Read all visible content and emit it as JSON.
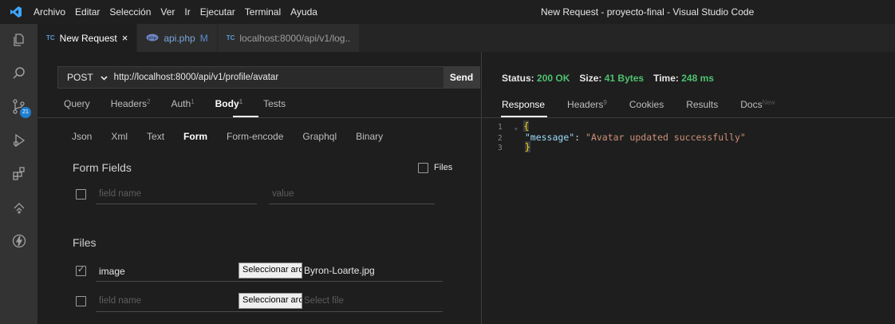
{
  "titlebar": {
    "logo": "⟩⟨",
    "menu": [
      "Archivo",
      "Editar",
      "Selección",
      "Ver",
      "Ir",
      "Ejecutar",
      "Terminal",
      "Ayuda"
    ],
    "window_title": "New Request - proyecto-final - Visual Studio Code"
  },
  "activity": {
    "icons": [
      "files-icon",
      "search-icon",
      "source-control-icon",
      "run-debug-icon",
      "extensions-icon",
      "remote-icon",
      "thunder-client-icon"
    ],
    "source_control_badge": "21"
  },
  "tabs": [
    {
      "label": "New Request",
      "prefix": "TC",
      "close": "×",
      "active": true
    },
    {
      "label": "api.php",
      "prefix": "php-icon",
      "modified": "M"
    },
    {
      "label": "localhost:8000/api/v1/log..",
      "prefix": "TC"
    }
  ],
  "request": {
    "method": "POST",
    "url": "http://localhost:8000/api/v1/profile/avatar",
    "send_label": "Send",
    "tabs": [
      {
        "label": "Query"
      },
      {
        "label": "Headers",
        "count": "2"
      },
      {
        "label": "Auth",
        "count": "1"
      },
      {
        "label": "Body",
        "count": "1",
        "active": true
      },
      {
        "label": "Tests"
      }
    ],
    "body_tabs": [
      "Json",
      "Xml",
      "Text",
      "Form",
      "Form-encode",
      "Graphql",
      "Binary"
    ],
    "body_tab_active": "Form",
    "form_fields_title": "Form Fields",
    "files_toggle_label": "Files",
    "field_name_placeholder": "field name",
    "value_placeholder": "value",
    "files_title": "Files",
    "file_rows": [
      {
        "name": "image",
        "button": "Seleccionar archivo",
        "file": "Byron-Loarte.jpg",
        "checked": true
      },
      {
        "name_placeholder": "field name",
        "button": "Seleccionar archivo",
        "file_placeholder": "Select file",
        "checked": false
      }
    ]
  },
  "response": {
    "status_label": "Status:",
    "status_value": "200 OK",
    "size_label": "Size:",
    "size_value": "41 Bytes",
    "time_label": "Time:",
    "time_value": "248 ms",
    "tabs": [
      {
        "label": "Response",
        "active": true
      },
      {
        "label": "Headers",
        "count": "9"
      },
      {
        "label": "Cookies"
      },
      {
        "label": "Results"
      },
      {
        "label": "Docs",
        "badge": "New"
      }
    ],
    "code": {
      "line1_no": "1",
      "fold": "⌄",
      "open": "{",
      "line2_no": "2",
      "key": "\"message\"",
      "colon": ": ",
      "value": "\"Avatar updated successfully\"",
      "line3_no": "3",
      "close": "}"
    }
  },
  "colors": {
    "accent_blue": "#3ea6ff",
    "status_green": "#4ec16f",
    "active_tab_underline": "#ffffff"
  }
}
